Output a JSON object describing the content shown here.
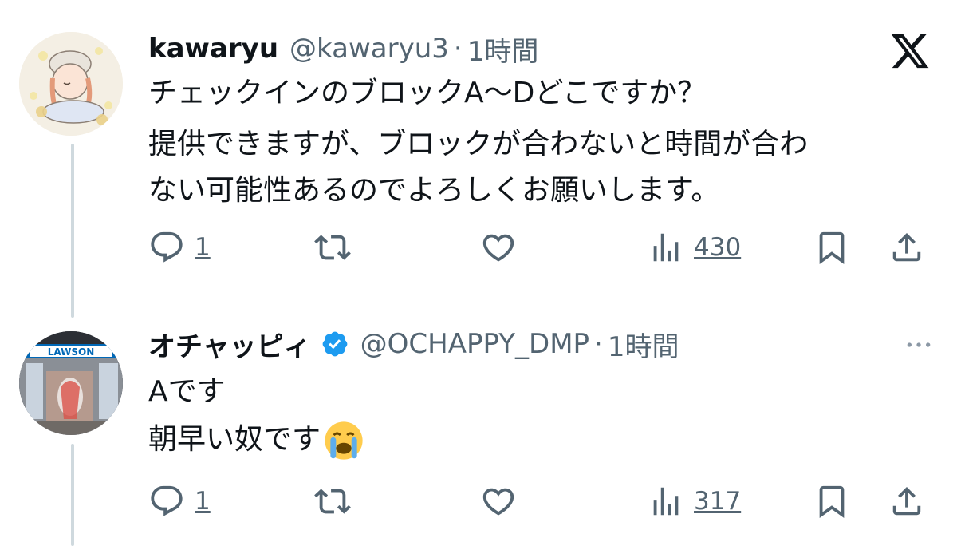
{
  "tweets": [
    {
      "name": "kawaryu",
      "handle": "@kawaryu3",
      "separator": "·",
      "time": "1時間",
      "lines": [
        "チェックインのブロックA〜Dどこですか？",
        "提供できますが、ブロックが合わないと時間が合わ",
        "ない可能性あるのでよろしくお願いします。"
      ],
      "replies": "1",
      "views": "430"
    },
    {
      "name": "オチャッピィ",
      "handle": "@OCHAPPY_DMP",
      "separator": "·",
      "time": "1時間",
      "verified": true,
      "lines": [
        "Aです",
        "朝早い奴です"
      ],
      "replies": "1",
      "views": "317",
      "avatar_sign": "LAWSON"
    }
  ],
  "icons": {
    "platform": "x-logo-icon",
    "reply": "speech-bubble-icon",
    "repost": "repost-arrows-icon",
    "like": "heart-icon",
    "views": "bar-chart-icon",
    "bookmark": "bookmark-icon",
    "share": "share-upload-icon",
    "more": "more-horizontal-icon",
    "emoji": "crying-face-emoji-icon",
    "verified": "verified-badge-icon"
  },
  "colors": {
    "text": "#0f1419",
    "secondary": "#536471",
    "verified": "#1d9bf0",
    "thread_line": "#cfd9de",
    "lawson_blue": "#0068b7"
  }
}
